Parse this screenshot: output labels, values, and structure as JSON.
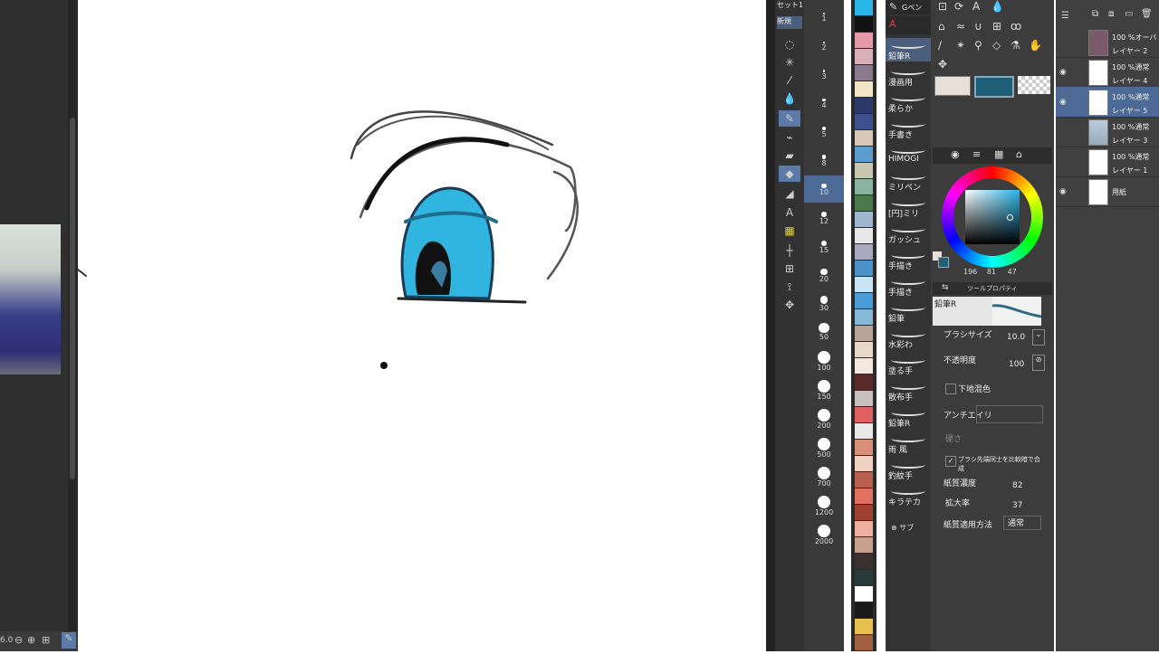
{
  "left_panel": {
    "zoom_value": "6.0"
  },
  "tool_header": {
    "set_label": "セット1",
    "new_label": "新規"
  },
  "tools": [
    "select",
    "lasso",
    "eyedropper",
    "fill-drop",
    "pen",
    "eraser",
    "blend",
    "gradient-fill",
    "figure",
    "text",
    "balloon",
    "ruler",
    "grid",
    "correction",
    "move"
  ],
  "brush_sizes": [
    "1",
    "2",
    "3",
    "4",
    "5",
    "8",
    "10",
    "12",
    "15",
    "20",
    "30",
    "50",
    "100",
    "150",
    "200",
    "500",
    "700",
    "1200",
    "2000"
  ],
  "palette_colors": [
    "#29b6e8",
    "#111111",
    "#e69aa8",
    "#d9b0b8",
    "#8a7a8f",
    "#f0e6c6",
    "#2a3a6a",
    "#3d4f8e",
    "#d7c8b8",
    "#5a9ed1",
    "#c8c8b0",
    "#8ab3a0",
    "#4a7a4a",
    "#9fb8cf",
    "#e8e8e8",
    "#a8a8c0",
    "#4d91c9",
    "#c9e4f6",
    "#4b9bd8",
    "#86b8d8",
    "#b7a59a",
    "#e8d8c8",
    "#f2e8e0",
    "#5a2a2a",
    "#c8c0c0",
    "#e06060",
    "#e8e8e8",
    "#d98f77",
    "#f0d0c0",
    "#b86050",
    "#e07060",
    "#a04030",
    "#f0b0a0",
    "#c8a090",
    "#3a3030",
    "#2a3a3a",
    "#ffffff",
    "#1a1a1a",
    "#e8c050",
    "#a06040"
  ],
  "sub_tool": {
    "header_label": "Gペン",
    "items": [
      "鉛筆R",
      "漫画用",
      "柔らか",
      "手書き",
      "HIMOGI",
      "ミリペン",
      "[円]ミリ",
      "ガッシュ",
      "手描き",
      "手描き",
      "鉛筆",
      "水彩わ",
      "塗る手",
      "散布手",
      "鉛筆R",
      "雨 風",
      "釣紋手",
      "キラテカ"
    ],
    "add_label": "サブ"
  },
  "color": {
    "main": "#e8e0d8",
    "sub": "#1f5f7a",
    "h": "196",
    "s": "81",
    "v": "47"
  },
  "tool_property": {
    "title": "ツールプロパティ",
    "brush_name": "鉛筆R",
    "brush_size_label": "ブラシサイズ",
    "brush_size_value": "10.0",
    "opacity_label": "不透明度",
    "opacity_value": "100",
    "blend_label": "下地混色",
    "antialias_label": "アンチエイリ",
    "hardness_label": "硬さ",
    "brush_tip_label": "ブラシ先端同士を比較暗で合成",
    "paper_density_label": "紙質濃度",
    "paper_density_value": "82",
    "zoom_label": "拡大率",
    "zoom_value": "37",
    "paper_method_label": "紙質適用方法",
    "paper_method_value": "通常"
  },
  "layers": [
    {
      "mode": "100 %オーバ",
      "name": "レイヤー 2",
      "visible": false
    },
    {
      "mode": "100 %通常",
      "name": "レイヤー 4",
      "visible": true
    },
    {
      "mode": "100 %通常",
      "name": "レイヤー 5",
      "visible": true
    },
    {
      "mode": "100 %通常",
      "name": "レイヤー 3",
      "visible": false
    },
    {
      "mode": "100 %通常",
      "name": "レイヤー 1",
      "visible": false
    },
    {
      "mode": "",
      "name": "用紙",
      "visible": true
    }
  ]
}
